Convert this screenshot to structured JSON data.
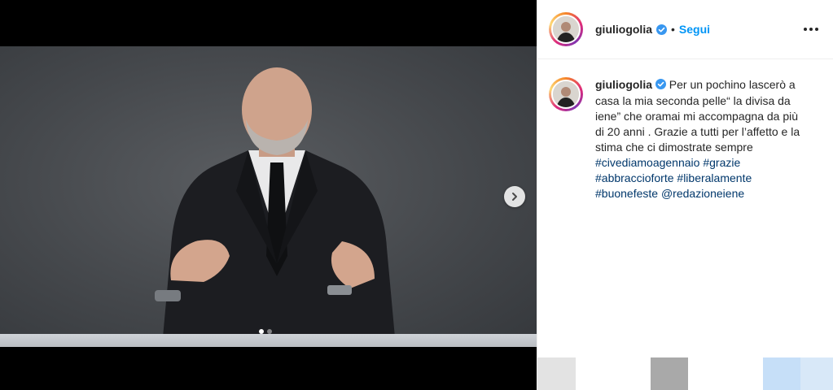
{
  "post": {
    "username": "giuliogolia",
    "follow_label": "Segui",
    "separator": "•",
    "caption_text": "Per un pochino lascerò a casa la mia seconda pelle“ la divisa da iene” che oramai mi accompagna da più di 20 anni . Grazie a tutti per l’affetto e la stima che ci dimostrate sempre ",
    "hashtags": [
      "#civediamoagennaio",
      "#grazie",
      "#abbraccioforte",
      "#liberalamente",
      "#buonefeste"
    ],
    "mention": "@redazioneiene"
  },
  "carousel": {
    "total_slides": 2,
    "current_slide": 1
  },
  "icons": {
    "verified": "verified-badge-icon",
    "more": "more-options-icon",
    "next": "chevron-right-icon"
  },
  "colors": {
    "link_blue": "#0095f6",
    "hashtag_blue": "#00376b",
    "verified_blue": "#3897f0",
    "text": "#262626"
  }
}
